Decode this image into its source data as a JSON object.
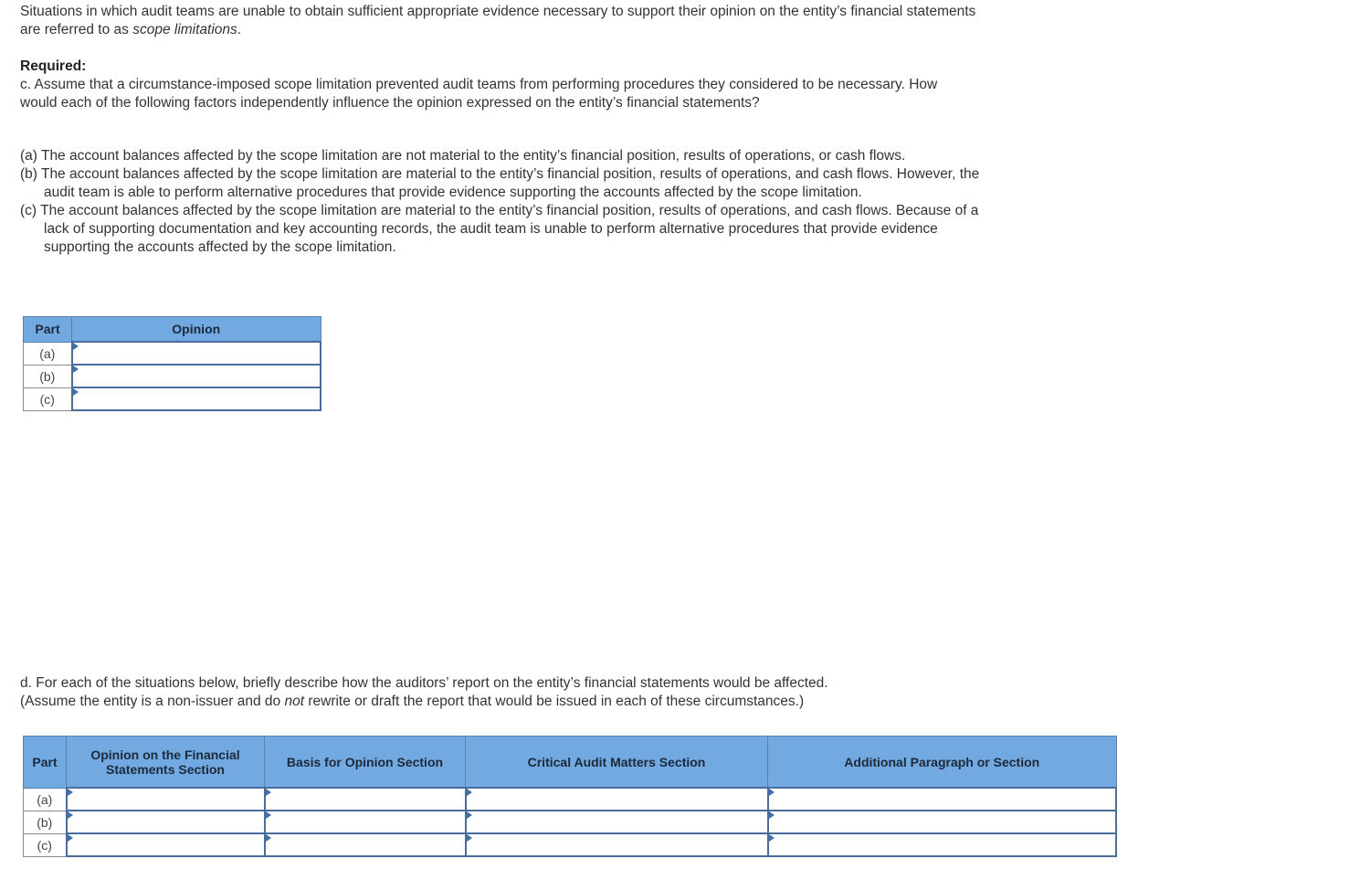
{
  "intro": {
    "text_before": "Situations in which audit teams are unable to obtain sufficient appropriate evidence necessary to support their opinion on the entity’s financial statements are referred to as ",
    "italic": "scope limitations",
    "text_after": "."
  },
  "required_label": "Required:",
  "part_c": {
    "question": "c. Assume that a circumstance-imposed scope limitation prevented audit teams from performing procedures they considered to be necessary. How would each of the following factors independently influence the opinion expressed on the entity’s financial statements?",
    "factors": [
      "(a) The account balances affected by the scope limitation are not material to the entity’s financial position, results of operations, or cash flows.",
      "(b) The account balances affected by the scope limitation are material to the entity’s financial position, results of operations, and cash flows. However, the audit team is able to perform alternative procedures that provide evidence supporting the accounts affected by the scope limitation.",
      "(c) The account balances affected by the scope limitation are material to the entity’s financial position, results of operations, and cash flows. Because of a lack of supporting documentation and key accounting records, the audit team is unable to perform alternative procedures that provide evidence supporting the accounts affected by the scope limitation."
    ],
    "table": {
      "headers": [
        "Part",
        "Opinion"
      ],
      "rows": [
        {
          "part": "(a)",
          "opinion": ""
        },
        {
          "part": "(b)",
          "opinion": ""
        },
        {
          "part": "(c)",
          "opinion": ""
        }
      ]
    }
  },
  "part_d": {
    "line1": "d. For each of the situations below, briefly describe how the auditors’ report on the entity’s financial statements would be affected.",
    "line2_before": "(Assume the entity is a non-issuer and do ",
    "line2_italic": "not",
    "line2_after": " rewrite or draft the report that would be issued in each of these circumstances.)",
    "table": {
      "headers": [
        "Part",
        "Opinion on the Financial Statements Section",
        "Basis for Opinion Section",
        "Critical Audit Matters Section",
        "Additional Paragraph or Section"
      ],
      "rows": [
        {
          "part": "(a)",
          "values": [
            "",
            "",
            "",
            ""
          ]
        },
        {
          "part": "(b)",
          "values": [
            "",
            "",
            "",
            ""
          ]
        },
        {
          "part": "(c)",
          "values": [
            "",
            "",
            "",
            ""
          ]
        }
      ]
    }
  },
  "colors": {
    "header_bg": "#72a9e0",
    "cell_border": "#4a6e9b",
    "flag": "#3f6ea8"
  }
}
